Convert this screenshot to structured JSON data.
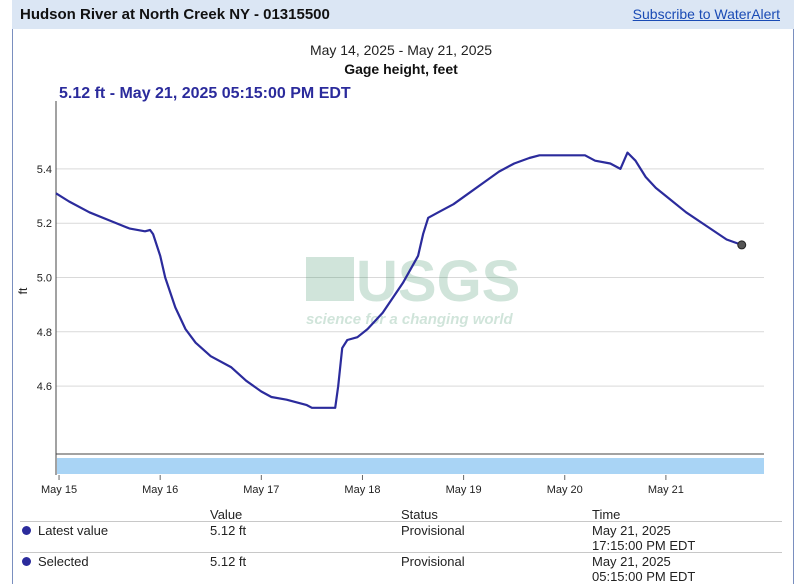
{
  "header": {
    "title": "Hudson River at North Creek NY - 01315500",
    "subscribe_label": "Subscribe to WaterAlert"
  },
  "chart_data": {
    "type": "line",
    "title": "May 14, 2025 - May 21, 2025",
    "subtitle": "Gage height, feet",
    "selected_label": "5.12 ft - May 21, 2025 05:15:00 PM EDT",
    "ylabel": "ft",
    "xlabel": "",
    "yticks": [
      "4.6",
      "4.8",
      "5.0",
      "5.2",
      "5.4"
    ],
    "ytick_values": [
      4.6,
      4.8,
      5.0,
      5.2,
      5.4
    ],
    "ylim": [
      4.35,
      5.65
    ],
    "xticks": [
      "May 15",
      "May 16",
      "May 17",
      "May 18",
      "May 19",
      "May 20",
      "May 21"
    ],
    "xtick_values": [
      1,
      2,
      3,
      4,
      5,
      6,
      7
    ],
    "xlim": [
      0.97,
      7.97
    ],
    "x_unit": "days after May 14, 2025 00:00",
    "watermark": [
      "USGS",
      "science for a changing world"
    ],
    "grid": true,
    "line_color": "#2b2b9c",
    "series": [
      {
        "name": "Gage height",
        "points": [
          [
            0.97,
            5.31
          ],
          [
            1.1,
            5.28
          ],
          [
            1.3,
            5.24
          ],
          [
            1.5,
            5.21
          ],
          [
            1.7,
            5.18
          ],
          [
            1.85,
            5.17
          ],
          [
            1.9,
            5.175
          ],
          [
            1.93,
            5.16
          ],
          [
            2.0,
            5.08
          ],
          [
            2.05,
            5.0
          ],
          [
            2.15,
            4.89
          ],
          [
            2.25,
            4.81
          ],
          [
            2.35,
            4.76
          ],
          [
            2.5,
            4.71
          ],
          [
            2.7,
            4.67
          ],
          [
            2.85,
            4.62
          ],
          [
            3.0,
            4.58
          ],
          [
            3.1,
            4.56
          ],
          [
            3.25,
            4.55
          ],
          [
            3.45,
            4.53
          ],
          [
            3.5,
            4.52
          ],
          [
            3.6,
            4.52
          ],
          [
            3.73,
            4.52
          ],
          [
            3.76,
            4.6
          ],
          [
            3.8,
            4.74
          ],
          [
            3.85,
            4.77
          ],
          [
            3.95,
            4.78
          ],
          [
            4.05,
            4.81
          ],
          [
            4.2,
            4.87
          ],
          [
            4.4,
            4.98
          ],
          [
            4.55,
            5.08
          ],
          [
            4.6,
            5.16
          ],
          [
            4.65,
            5.22
          ],
          [
            4.75,
            5.24
          ],
          [
            4.9,
            5.27
          ],
          [
            5.05,
            5.31
          ],
          [
            5.2,
            5.35
          ],
          [
            5.35,
            5.39
          ],
          [
            5.5,
            5.42
          ],
          [
            5.65,
            5.44
          ],
          [
            5.75,
            5.45
          ],
          [
            6.0,
            5.45
          ],
          [
            6.2,
            5.45
          ],
          [
            6.3,
            5.43
          ],
          [
            6.45,
            5.42
          ],
          [
            6.55,
            5.4
          ],
          [
            6.62,
            5.46
          ],
          [
            6.7,
            5.43
          ],
          [
            6.8,
            5.37
          ],
          [
            6.9,
            5.33
          ],
          [
            7.0,
            5.3
          ],
          [
            7.2,
            5.24
          ],
          [
            7.4,
            5.19
          ],
          [
            7.6,
            5.14
          ],
          [
            7.75,
            5.12
          ]
        ]
      }
    ],
    "selected_point": [
      7.75,
      5.12
    ]
  },
  "table": {
    "headers": {
      "value": "Value",
      "status": "Status",
      "time": "Time"
    },
    "rows": [
      {
        "label": "Latest value",
        "value": "5.12 ft",
        "status": "Provisional",
        "time_line1": "May 21, 2025",
        "time_line2": "17:15:00 PM EDT"
      },
      {
        "label": "Selected",
        "value": "5.12 ft",
        "status": "Provisional",
        "time_line1": "May 21, 2025",
        "time_line2": "05:15:00 PM EDT"
      }
    ]
  }
}
